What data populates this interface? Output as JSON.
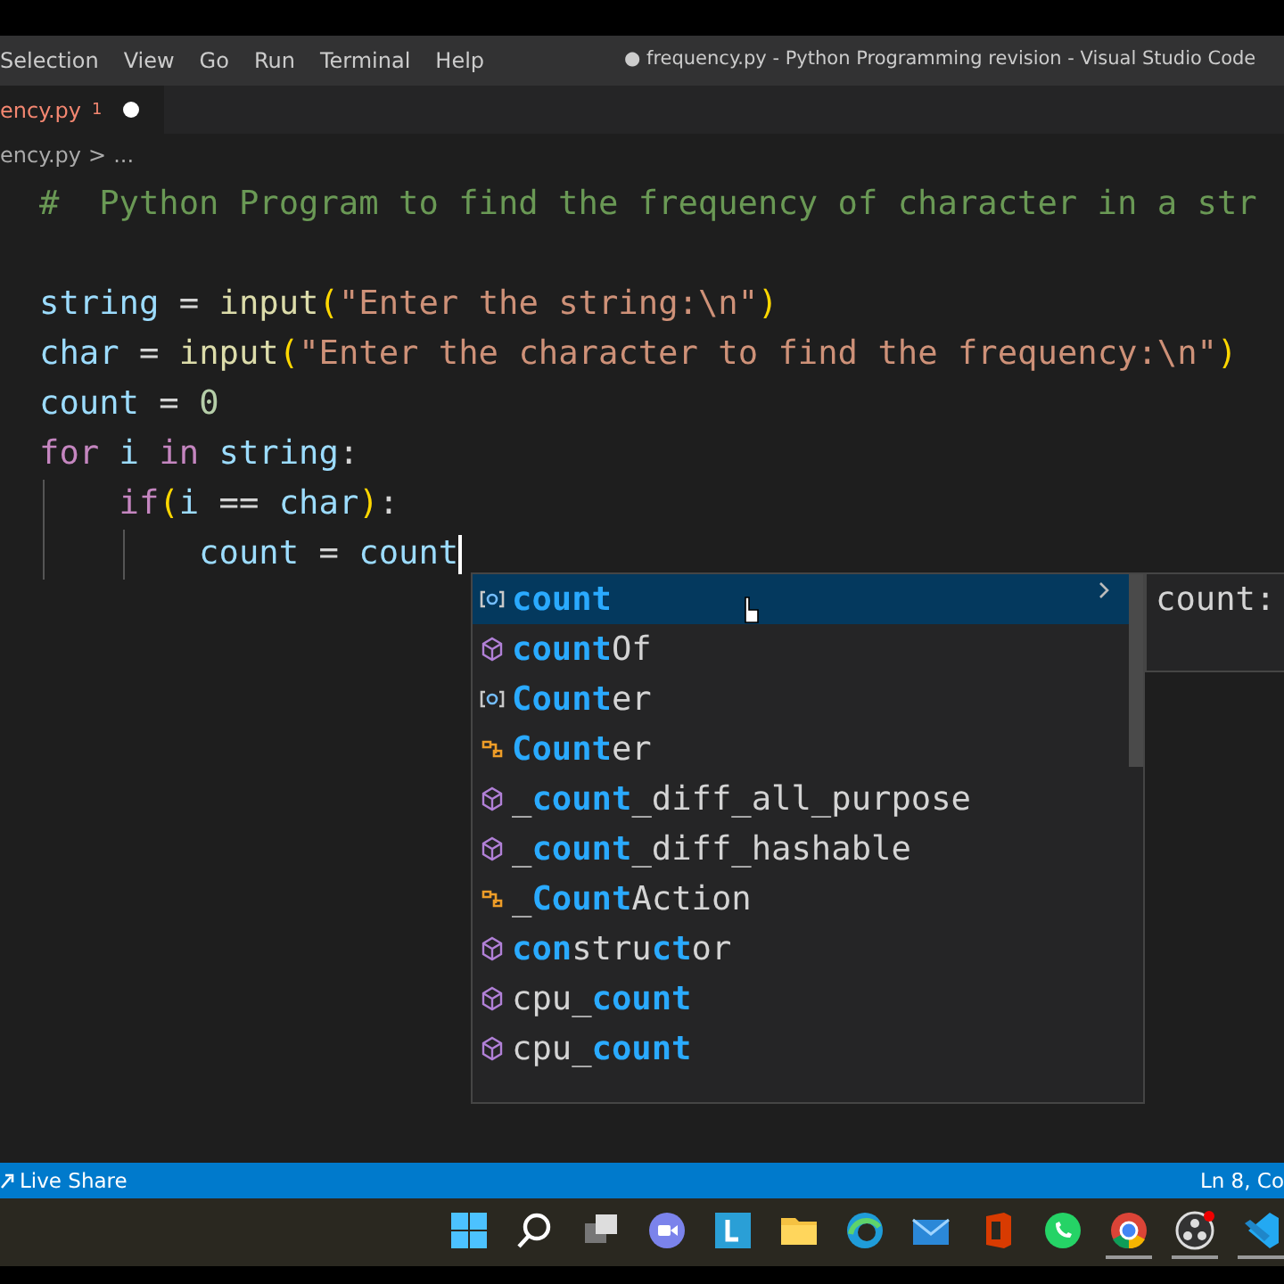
{
  "window": {
    "title": "● frequency.py - Python Programming revision - Visual Studio Code"
  },
  "menu": [
    "Selection",
    "View",
    "Go",
    "Run",
    "Terminal",
    "Help"
  ],
  "tab": {
    "label": "ency.py",
    "problems": "1",
    "modified": true
  },
  "breadcrumb": {
    "file": "ency.py",
    "separator": ">",
    "rest": "..."
  },
  "editor": {
    "lines": [
      {
        "cursor": false,
        "tokens": [
          {
            "text": "#  Python Program to find the frequency of character in a str",
            "kind": "comment"
          }
        ]
      },
      {
        "cursor": false
      },
      {
        "cursor": false,
        "tokens": [
          {
            "text": "string",
            "kind": "var"
          },
          {
            "text": " = ",
            "kind": "op"
          },
          {
            "text": "input",
            "kind": "func"
          },
          {
            "text": "(",
            "kind": "paren"
          },
          {
            "text": "\"Enter the string:\\n\"",
            "kind": "string"
          },
          {
            "text": ")",
            "kind": "paren"
          }
        ]
      },
      {
        "cursor": false,
        "tokens": [
          {
            "text": "char",
            "kind": "var"
          },
          {
            "text": " = ",
            "kind": "op"
          },
          {
            "text": "input",
            "kind": "func"
          },
          {
            "text": "(",
            "kind": "paren"
          },
          {
            "text": "\"Enter the character to find the frequency:\\n\"",
            "kind": "string"
          },
          {
            "text": ")",
            "kind": "paren"
          }
        ]
      },
      {
        "cursor": false,
        "tokens": [
          {
            "text": "count",
            "kind": "var"
          },
          {
            "text": " = ",
            "kind": "op"
          },
          {
            "text": "0",
            "kind": "number"
          }
        ]
      },
      {
        "cursor": false,
        "tokens": [
          {
            "text": "for",
            "kind": "keyword"
          },
          {
            "text": " i ",
            "kind": "var"
          },
          {
            "text": "in",
            "kind": "keyword"
          },
          {
            "text": " string",
            "kind": "var"
          },
          {
            "text": ":",
            "kind": "op"
          }
        ]
      },
      {
        "cursor": false,
        "tokens": [
          {
            "text": "    if",
            "kind": "keyword"
          },
          {
            "text": "(",
            "kind": "paren"
          },
          {
            "text": "i",
            "kind": "var"
          },
          {
            "text": " == ",
            "kind": "op"
          },
          {
            "text": "char",
            "kind": "var"
          },
          {
            "text": ")",
            "kind": "paren"
          },
          {
            "text": ":",
            "kind": "op"
          }
        ]
      },
      {
        "cursor": true,
        "tokens": [
          {
            "text": "        count",
            "kind": "var"
          },
          {
            "text": " = ",
            "kind": "op"
          },
          {
            "text": "count",
            "kind": "var"
          }
        ]
      }
    ]
  },
  "suggest": {
    "detail": "count:",
    "items": [
      {
        "kind": "variable",
        "selected": true,
        "segments": [
          {
            "text": "count",
            "match": true
          }
        ]
      },
      {
        "kind": "method",
        "selected": false,
        "segments": [
          {
            "text": "count",
            "match": true
          },
          {
            "text": "Of",
            "match": false
          }
        ]
      },
      {
        "kind": "variable",
        "selected": false,
        "segments": [
          {
            "text": "Count",
            "match": true
          },
          {
            "text": "er",
            "match": false
          }
        ]
      },
      {
        "kind": "class",
        "selected": false,
        "segments": [
          {
            "text": "Count",
            "match": true
          },
          {
            "text": "er",
            "match": false
          }
        ]
      },
      {
        "kind": "method",
        "selected": false,
        "segments": [
          {
            "text": "_",
            "match": false
          },
          {
            "text": "count",
            "match": true
          },
          {
            "text": "_diff_all_purpose",
            "match": false
          }
        ]
      },
      {
        "kind": "method",
        "selected": false,
        "segments": [
          {
            "text": "_",
            "match": false
          },
          {
            "text": "count",
            "match": true
          },
          {
            "text": "_diff_hashable",
            "match": false
          }
        ]
      },
      {
        "kind": "class",
        "selected": false,
        "segments": [
          {
            "text": "_",
            "match": false
          },
          {
            "text": "Count",
            "match": true
          },
          {
            "text": "Action",
            "match": false
          }
        ]
      },
      {
        "kind": "method",
        "selected": false,
        "segments": [
          {
            "text": "con",
            "match": true
          },
          {
            "text": "stru",
            "match": false
          },
          {
            "text": "ct",
            "match": true
          },
          {
            "text": "or",
            "match": false
          }
        ]
      },
      {
        "kind": "method",
        "selected": false,
        "segments": [
          {
            "text": "cpu_",
            "match": false
          },
          {
            "text": "count",
            "match": true
          }
        ]
      },
      {
        "kind": "method",
        "selected": false,
        "segments": [
          {
            "text": "cpu_",
            "match": false
          },
          {
            "text": "count",
            "match": true
          }
        ]
      }
    ]
  },
  "status_bar": {
    "left": "Live Share",
    "right": "Ln 8, Co"
  },
  "taskbar": {
    "apps": [
      {
        "kind": "start",
        "running": false
      },
      {
        "kind": "search",
        "running": false
      },
      {
        "kind": "taskview",
        "running": false
      },
      {
        "kind": "chat",
        "running": false
      },
      {
        "kind": "letter",
        "running": false
      },
      {
        "kind": "folder",
        "running": false
      },
      {
        "kind": "browser",
        "running": false
      },
      {
        "kind": "mail",
        "running": false
      },
      {
        "kind": "office",
        "running": false
      },
      {
        "kind": "phone",
        "running": false
      },
      {
        "kind": "chrome",
        "running": true
      },
      {
        "kind": "recorder",
        "running": true
      },
      {
        "kind": "editor",
        "running": true
      }
    ]
  }
}
